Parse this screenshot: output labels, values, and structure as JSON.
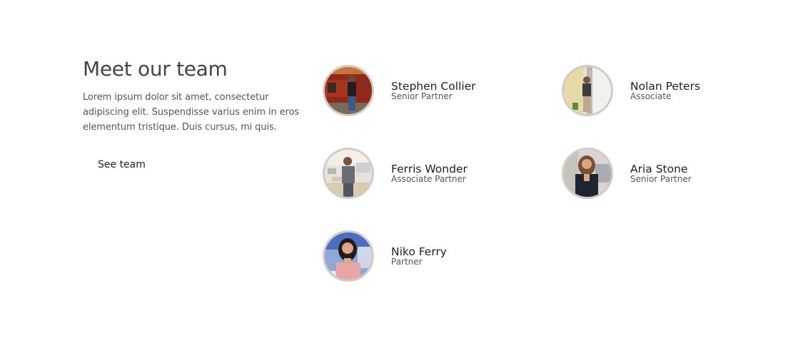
{
  "intro": {
    "title": "Meet our team",
    "description": "Lorem ipsum dolor sit amet, consectetur adipiscing elit. Suspendisse varius enim in eros elementum tristique. Duis cursus, mi quis.",
    "button_label": "See team"
  },
  "members": [
    {
      "name": "Stephen Collier",
      "role": "Senior Partner"
    },
    {
      "name": "Nolan Peters",
      "role": "Associate"
    },
    {
      "name": "Ferris Wonder",
      "role": "Associate Partner"
    },
    {
      "name": "Aria Stone",
      "role": "Senior Partner"
    },
    {
      "name": "Niko Ferry",
      "role": "Partner"
    }
  ],
  "colors": {
    "avatar_border": "#d3cbc4",
    "heading": "#444444",
    "body_text": "#555555"
  }
}
